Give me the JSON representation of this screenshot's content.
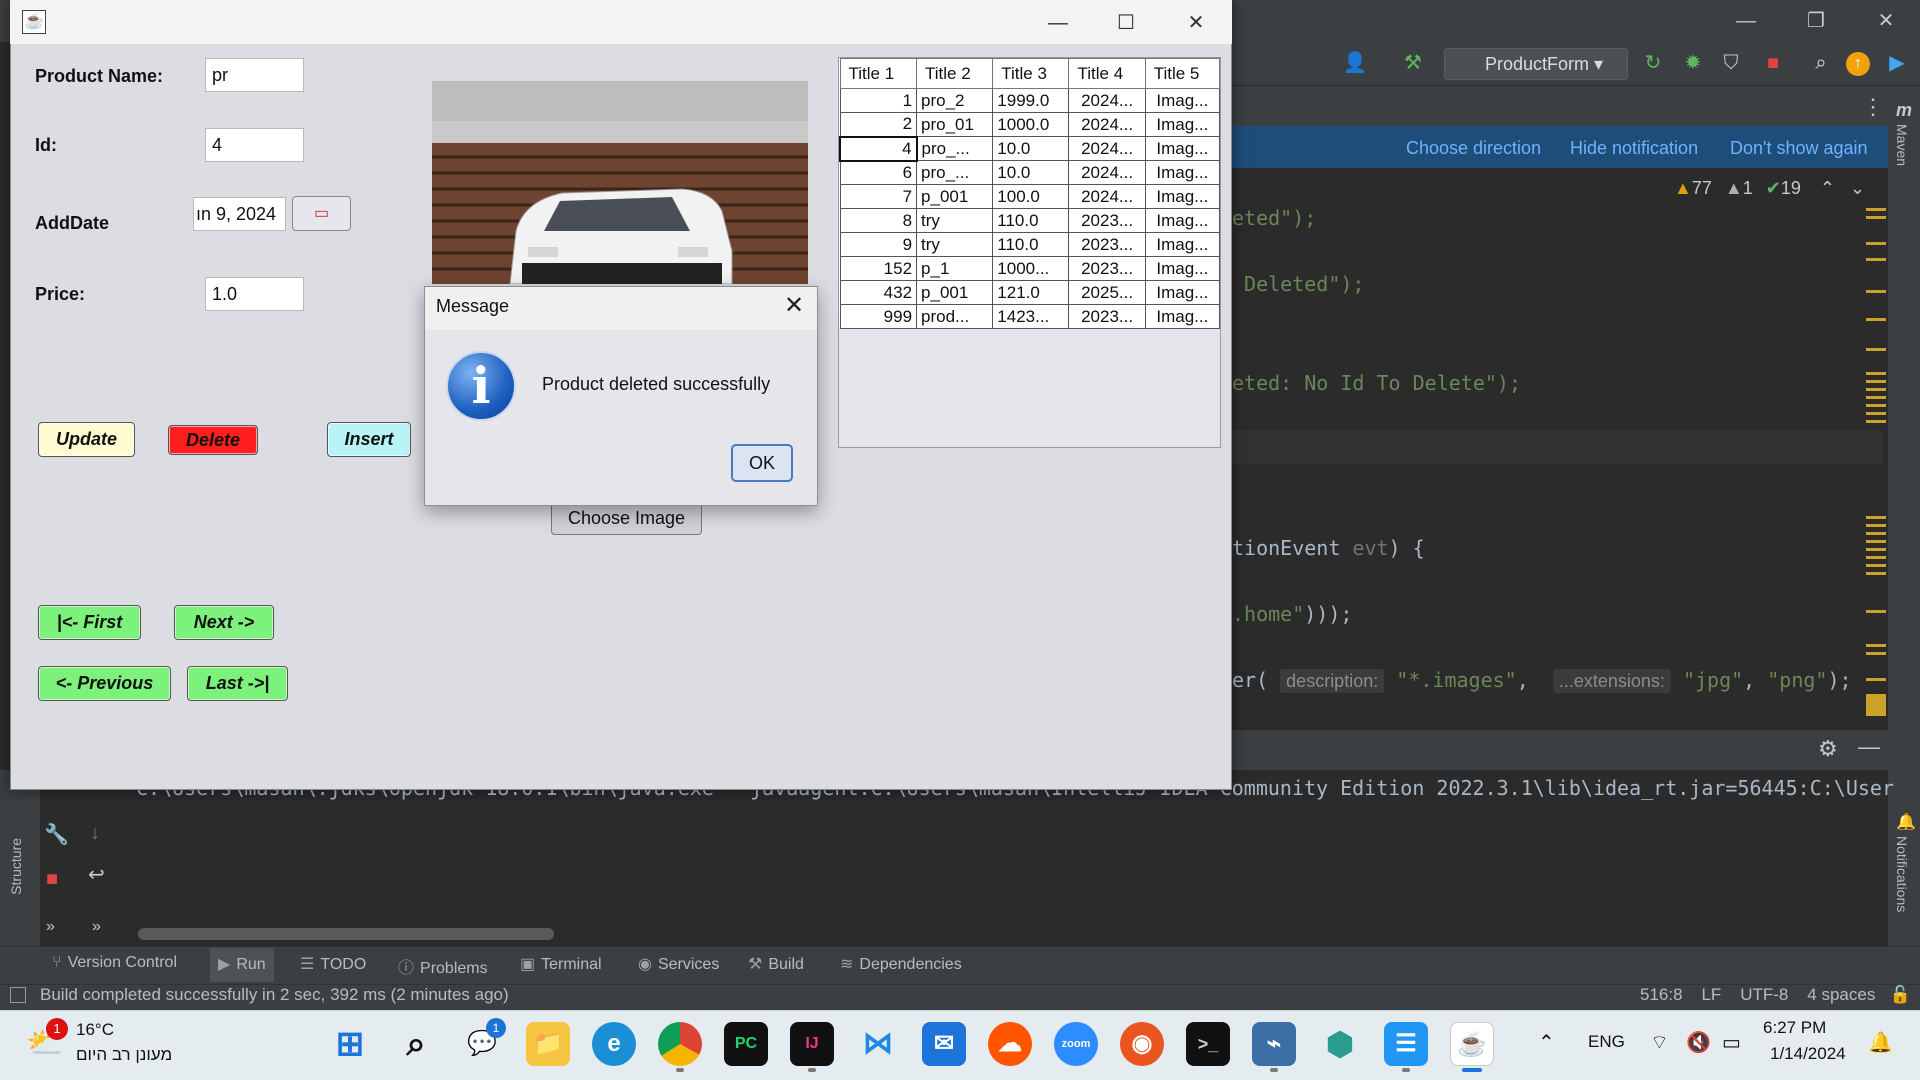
{
  "ide": {
    "run_config": "ProductForm",
    "notification_links": [
      "Choose direction",
      "Hide notification",
      "Don't show again"
    ],
    "inspections": {
      "warnings": "77",
      "weak_warnings": "1",
      "ok": "19"
    },
    "code_lines": {
      "l1_code": "eted\");",
      "l2_code": " Deleted\");",
      "l3_code": "eted: No Id To Delete\");",
      "l4_code": "tionEvent ",
      "l4_param": "evt",
      "l4_tail": ") {",
      "l5_str": ".home\"",
      "l5_tail": ")));",
      "l6_code": "er(",
      "l6_hint1": "description:",
      "l6_str1": "\"*.images\"",
      "l6_comma": ", ",
      "l6_hint2": "...extensions:",
      "l6_str2": "\"jpg\"",
      "l6_str3": "\"png\"",
      "l6_tail": ");"
    },
    "console_line": "C:\\Users\\masan\\.jdks\\openjdk-18.0.1\\bin\\java.exe \"-javaagent:C:\\Users\\masan\\IntelliJ IDEA Community Edition 2022.3.1\\lib\\idea_rt.jar=56445:C:\\User",
    "left_strip_label": "Structure",
    "right_strip_labels": {
      "maven": "Maven",
      "notifications": "Notifications"
    },
    "bottom_tabs": [
      "Version Control",
      "Run",
      "TODO",
      "Problems",
      "Terminal",
      "Services",
      "Build",
      "Dependencies"
    ],
    "status_text": "Build completed successfully in 2 sec, 392 ms (2 minutes ago)",
    "status_right": {
      "position": "516:8",
      "line_sep": "LF",
      "encoding": "UTF-8",
      "indent": "4 spaces"
    }
  },
  "app": {
    "labels": {
      "product_name": "Product Name:",
      "id": "Id:",
      "add_date": "AddDate",
      "price": "Price:"
    },
    "fields": {
      "product_name": "pr",
      "id": "4",
      "add_date": "ın 9, 2024",
      "price": "1.0"
    },
    "buttons": {
      "update": "Update",
      "delete": "Delete",
      "insert": "Insert",
      "first": "|<- First",
      "next": "Next ->",
      "previous": "<- Previous",
      "last": "Last ->|",
      "choose_image": "Choose Image"
    },
    "colors": {
      "update": "#fffbd0",
      "delete": "#ff1f1f",
      "insert": "#b9f3f5",
      "nav": "#7cf27c"
    },
    "table": {
      "headers": [
        "Title 1",
        "Title 2",
        "Title 3",
        "Title 4",
        "Title 5"
      ],
      "rows": [
        [
          "1",
          "pro_2",
          "1999.0",
          "2024...",
          "Imag..."
        ],
        [
          "2",
          "pro_01",
          "1000.0",
          "2024...",
          "Imag..."
        ],
        [
          "4",
          "pro_...",
          "10.0",
          "2024...",
          "Imag..."
        ],
        [
          "6",
          "pro_...",
          "10.0",
          "2024...",
          "Imag..."
        ],
        [
          "7",
          "p_001",
          "100.0",
          "2024...",
          "Imag..."
        ],
        [
          "8",
          "try",
          "110.0",
          "2023...",
          "Imag..."
        ],
        [
          "9",
          "try",
          "110.0",
          "2023...",
          "Imag..."
        ],
        [
          "152",
          "p_1",
          "1000...",
          "2023...",
          "Imag..."
        ],
        [
          "432",
          "p_001",
          "121.0",
          "2025...",
          "Imag..."
        ],
        [
          "999",
          "prod...",
          "1423...",
          "2023...",
          "Imag..."
        ]
      ]
    }
  },
  "dialog": {
    "title": "Message",
    "message": "Product deleted successfully",
    "ok": "OK"
  },
  "taskbar": {
    "weather_temp": "16°C",
    "weather_desc": "מעונן רב היום",
    "weather_badge": "1",
    "chat_badge": "1",
    "lang": "ENG",
    "time": "6:27 PM",
    "date": "1/14/2024"
  }
}
